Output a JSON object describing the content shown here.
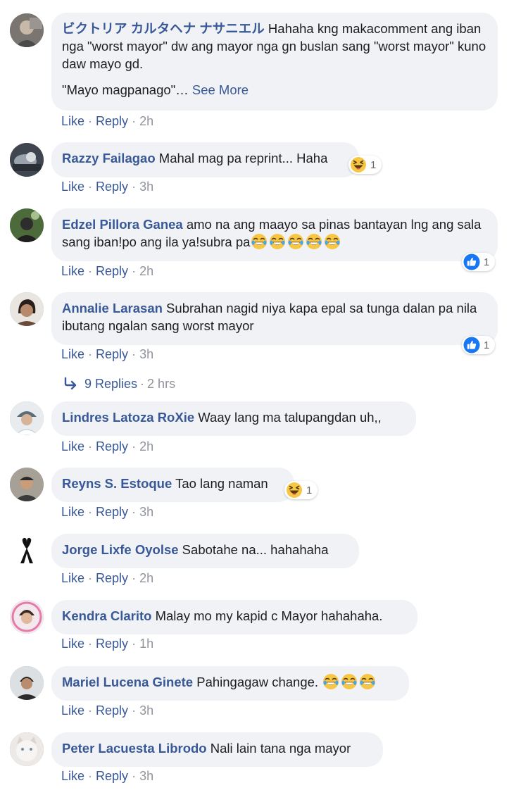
{
  "actions": {
    "like": "Like",
    "reply": "Reply",
    "sep": "·"
  },
  "colors": {
    "link": "#385898",
    "bubble": "#f0f2f5",
    "meta": "#90949c",
    "like_blue": "#1877f2"
  },
  "comments": [
    {
      "author": "ビクトリア カルタヘナ ナサニエル",
      "text": " Hahaha kng makacomment ang iban nga \"worst mayor\" dw ang mayor nga gn buslan sang \"worst mayor\" kuno daw mayo gd.",
      "text2": "\"Mayo magpanago\"…",
      "see_more": "See More",
      "time": "2h"
    },
    {
      "author": "Razzy Failagao",
      "text": " Mahal mag pa reprint... Haha",
      "time": "3h",
      "reaction": {
        "icon": "haha-icon",
        "count": "1"
      }
    },
    {
      "author": "Edzel Pillora Ganea",
      "text": " amo na ang maayo sa pinas bantayan lng ang sala sang iban!po ang ila ya!subra pa",
      "emojis": [
        "tears-of-joy-icon",
        "tears-of-joy-icon",
        "tears-of-joy-icon",
        "tears-of-joy-icon",
        "tears-of-joy-icon"
      ],
      "time": "2h",
      "reaction": {
        "icon": "like-icon",
        "count": "1"
      }
    },
    {
      "author": "Annalie Larasan",
      "text": " Subrahan nagid niya kapa epal sa tunga dalan pa nila ibutang ngalan sang worst mayor",
      "time": "3h",
      "reaction": {
        "icon": "like-icon",
        "count": "1"
      }
    },
    {
      "author": "Lindres Latoza RoXie",
      "text": " Waay lang ma talupangdan uh,,",
      "time": "2h"
    },
    {
      "author": "Reyns S. Estoque",
      "text": " Tao lang naman",
      "time": "3h",
      "reaction": {
        "icon": "haha-icon",
        "count": "1"
      }
    },
    {
      "author": "Jorge Lixfe Oyolse",
      "text": " Sabotahe na... hahahaha",
      "time": "2h"
    },
    {
      "author": "Kendra Clarito",
      "text": " Malay mo my kapid c Mayor hahahaha.",
      "time": "1h"
    },
    {
      "author": "Mariel Lucena Ginete",
      "text": " Pahingagaw change. ",
      "emojis": [
        "tears-of-joy-icon",
        "tears-of-joy-icon",
        "tears-of-joy-icon"
      ],
      "time": "3h"
    },
    {
      "author": "Peter Lacuesta Librodo",
      "text": " Nali lain tana nga mayor",
      "time": "3h"
    }
  ],
  "replies": {
    "label": "9 Replies",
    "time": "2 hrs"
  }
}
